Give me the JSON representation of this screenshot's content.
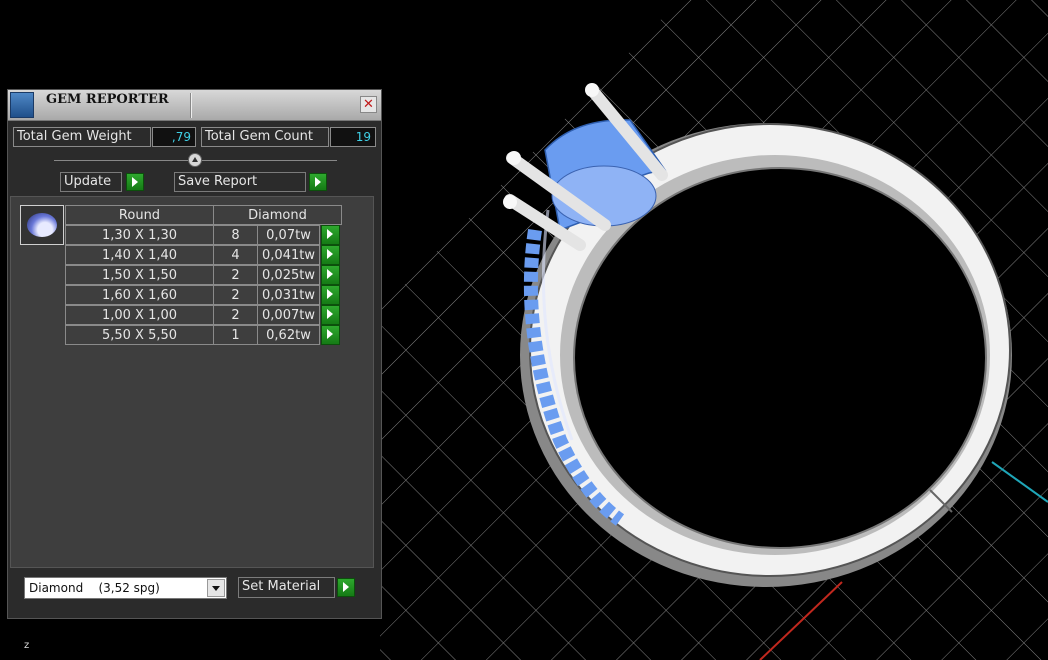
{
  "window": {
    "title": "GEM REPORTER",
    "close_glyph": "✕"
  },
  "totals": {
    "weight_label": "Total Gem Weight",
    "weight_value": ",79",
    "count_label": "Total Gem Count",
    "count_value": "19"
  },
  "buttons": {
    "update_label": "Update",
    "save_report_label": "Save Report",
    "set_material_label": "Set Material"
  },
  "gem_table": {
    "shape_header": "Round",
    "material_header": "Diamond",
    "rows": [
      {
        "size": "1,30 X 1,30",
        "count": "8",
        "weight": "0,07tw"
      },
      {
        "size": "1,40 X 1,40",
        "count": "4",
        "weight": "0,041tw"
      },
      {
        "size": "1,50 X 1,50",
        "count": "2",
        "weight": "0,025tw"
      },
      {
        "size": "1,60 X 1,60",
        "count": "2",
        "weight": "0,031tw"
      },
      {
        "size": "1,00 X 1,00",
        "count": "2",
        "weight": "0,007tw"
      },
      {
        "size": "5,50 X 5,50",
        "count": "1",
        "weight": "0,62tw"
      }
    ]
  },
  "material_select": {
    "selected": "Diamond    (3,52 spg)"
  },
  "viewport": {
    "axis_label": "z"
  },
  "colors": {
    "accent_value": "#3fd0e6",
    "play_green": "#1f9a1f",
    "gem_blue": "#6a9cf0"
  },
  "icons": [
    "gem-reporter-app-icon",
    "close-icon",
    "slider-knob-icon",
    "play-icon",
    "round-gem-icon",
    "dropdown-arrow-icon"
  ]
}
